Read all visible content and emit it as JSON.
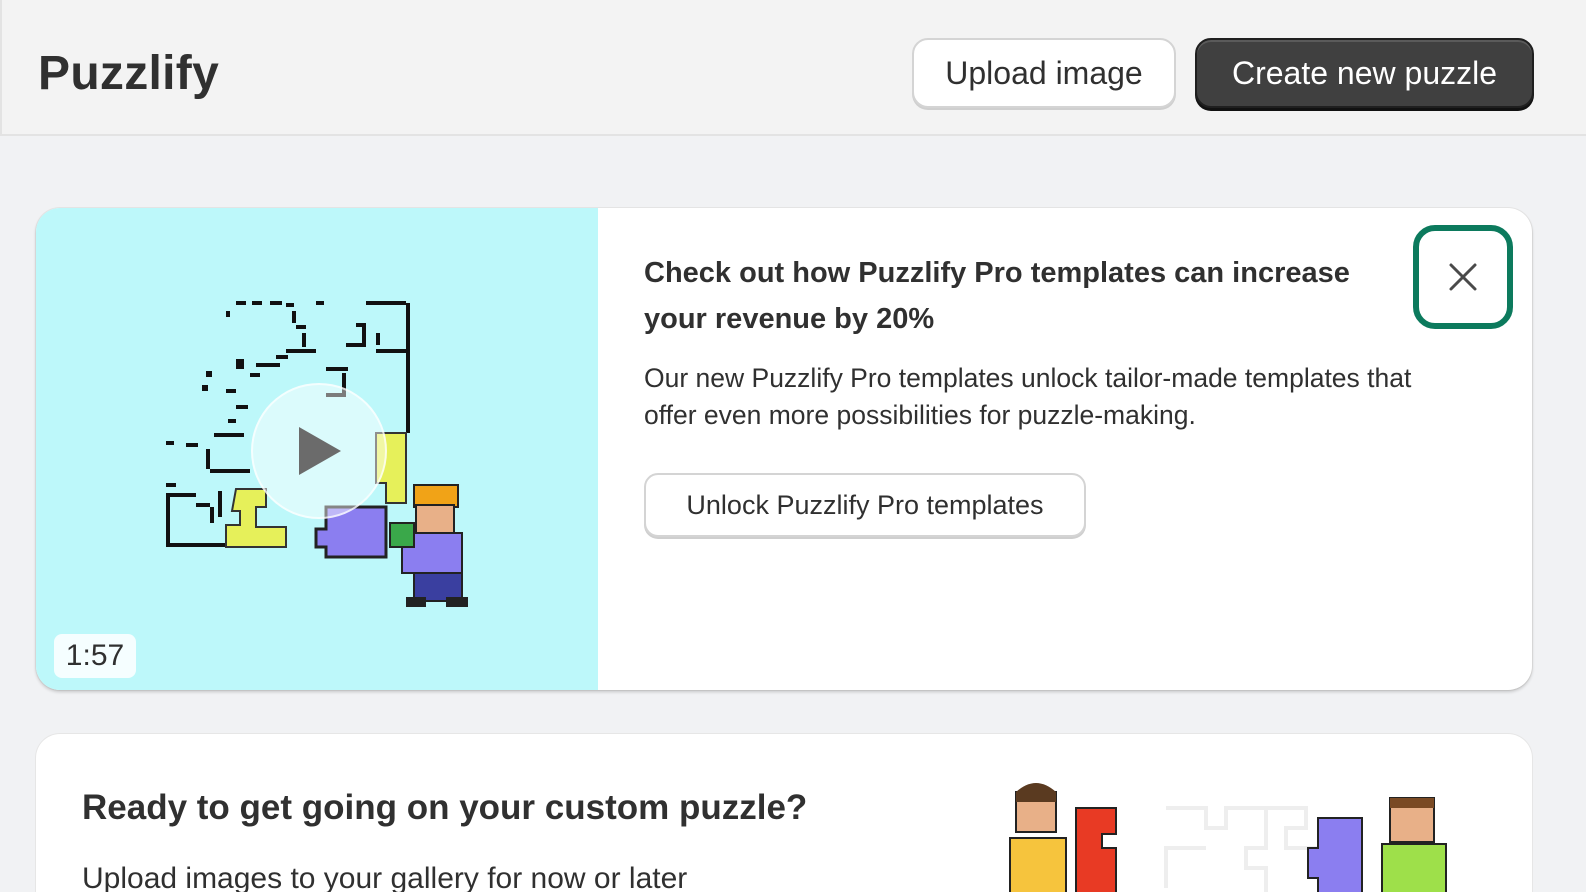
{
  "header": {
    "app_title": "Puzzlify",
    "upload_label": "Upload image",
    "create_label": "Create new puzzle"
  },
  "promo": {
    "video_duration": "1:57",
    "heading": "Check out how Puzzlify Pro templates can increase your revenue by 20%",
    "body": "Our new Puzzlify Pro templates unlock tailor-made templates that offer even more possibilities for puzzle-making.",
    "cta_label": "Unlock Puzzlify Pro templates",
    "close_icon": "close-icon",
    "play_icon": "play-icon"
  },
  "getting_started": {
    "heading": "Ready to get going on your custom puzzle?",
    "body": "Upload images to your gallery for now or later"
  },
  "colors": {
    "primary_button": "#404040",
    "video_background": "#bdf8fa",
    "focus_ring": "#0c7a5d",
    "page_background": "#f1f2f4"
  }
}
